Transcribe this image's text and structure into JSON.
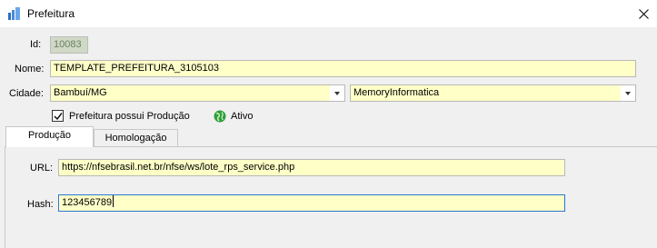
{
  "window": {
    "title": "Prefeitura",
    "icon": "app-icon"
  },
  "form": {
    "id_label": "Id:",
    "id_value": "10083",
    "nome_label": "Nome:",
    "nome_value": "TEMPLATE_PREFEITURA_3105103",
    "cidade_label": "Cidade:",
    "cidade_value": "Bambuí/MG",
    "provedor_value": "MemoryInformatica",
    "producao_checkbox_label": "Prefeitura possui Produção",
    "producao_checked": true,
    "status_label": "Ativo",
    "status_color": "#2e9e3e"
  },
  "tabs": [
    {
      "label": "Produção",
      "active": true
    },
    {
      "label": "Homologação",
      "active": false
    }
  ],
  "panel": {
    "url_label": "URL:",
    "url_value": "https://nfsebrasil.net.br/nfse/ws/lote_rps_service.php",
    "hash_label": "Hash:",
    "hash_value": "123456789"
  },
  "colors": {
    "field_bg": "#ffffc8",
    "readonly_bg": "#cfd9c5",
    "focus_border": "#2a78d4"
  }
}
